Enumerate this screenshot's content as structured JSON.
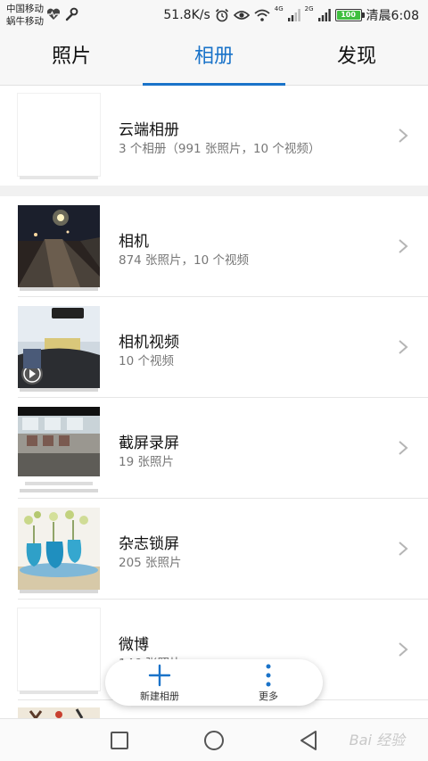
{
  "status_bar": {
    "carrier_line1": "中国移动",
    "carrier_line2": "蜗牛移动",
    "net_speed": "51.8K/s",
    "net_type_1": "4G",
    "net_type_2": "2G",
    "battery": "100",
    "time": "清晨6:08",
    "icons": [
      "heart-rate-icon",
      "wrench-icon",
      "alarm-icon",
      "eye-icon",
      "wifi-icon",
      "signal-icon",
      "signal-icon",
      "battery-icon"
    ]
  },
  "tabs": [
    {
      "label": "照片",
      "active": false
    },
    {
      "label": "相册",
      "active": true
    },
    {
      "label": "发现",
      "active": false
    }
  ],
  "accent_color": "#1a73c9",
  "cloud_album": {
    "title": "云端相册",
    "subtitle": "3 个相册（991 张照片，10 个视频）"
  },
  "albums": [
    {
      "title": "相机",
      "subtitle": "874 张照片，10 个视频"
    },
    {
      "title": "相机视频",
      "subtitle": "10 个视频"
    },
    {
      "title": "截屏录屏",
      "subtitle": "19 张照片"
    },
    {
      "title": "杂志锁屏",
      "subtitle": "205 张照片"
    },
    {
      "title": "微博",
      "subtitle": "146 张照片"
    }
  ],
  "actions": {
    "new_album": "新建相册",
    "more": "更多"
  },
  "watermark": "Bai 经验"
}
